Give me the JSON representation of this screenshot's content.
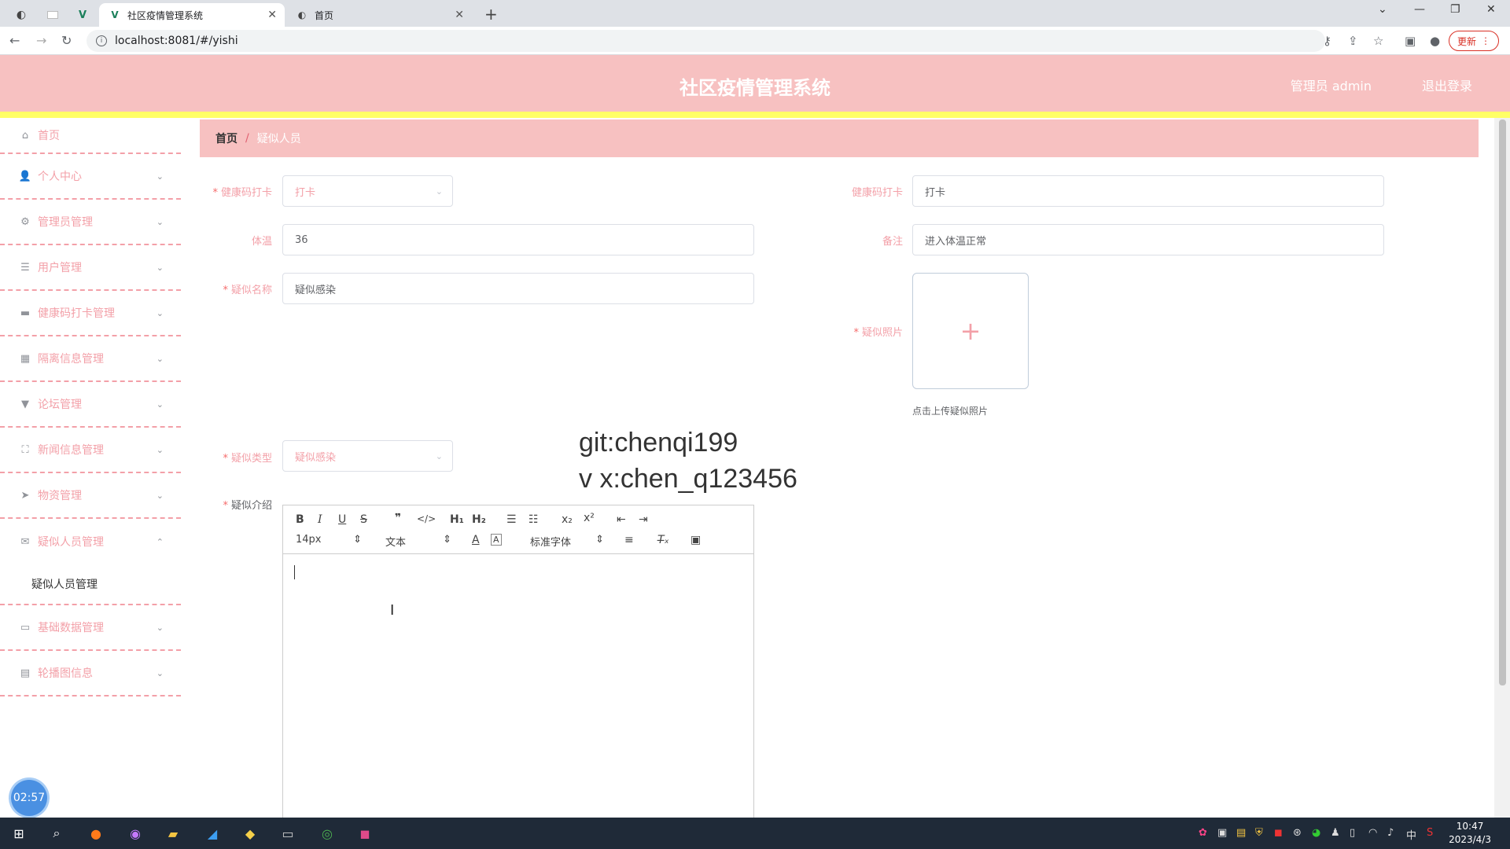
{
  "browser": {
    "tabs": [
      {
        "title": "社区疫情管理系统",
        "active": true
      },
      {
        "title": "首页",
        "active": false
      }
    ],
    "new_tab": "+",
    "url": "localhost:8081/#/yishi",
    "update_label": "更新"
  },
  "header": {
    "title": "社区疫情管理系统",
    "user": "管理员 admin",
    "logout": "退出登录"
  },
  "sidebar": {
    "items": [
      {
        "label": "首页",
        "icon": "home-icon"
      },
      {
        "label": "个人中心",
        "icon": "user-icon"
      },
      {
        "label": "管理员管理",
        "icon": "settings-icon"
      },
      {
        "label": "用户管理",
        "icon": "sliders-icon"
      },
      {
        "label": "健康码打卡管理",
        "icon": "briefcase-icon"
      },
      {
        "label": "隔离信息管理",
        "icon": "grid-icon"
      },
      {
        "label": "论坛管理",
        "icon": "pin-icon"
      },
      {
        "label": "新闻信息管理",
        "icon": "fullscreen-icon"
      },
      {
        "label": "物资管理",
        "icon": "send-icon"
      },
      {
        "label": "疑似人员管理",
        "icon": "ticket-icon"
      },
      {
        "label": "基础数据管理",
        "icon": "monitor-icon"
      },
      {
        "label": "轮播图信息",
        "icon": "clipboard-icon"
      }
    ],
    "submenu": {
      "label": "疑似人员管理"
    }
  },
  "breadcrumb": {
    "home": "首页",
    "separator": "/",
    "current": "疑似人员"
  },
  "form": {
    "health_checkin_select": {
      "label": "健康码打卡",
      "placeholder": "打卡"
    },
    "health_checkin_text": {
      "label": "健康码打卡",
      "value": "打卡"
    },
    "temperature": {
      "label": "体温",
      "value": "36"
    },
    "remark": {
      "label": "备注",
      "value": "进入体温正常"
    },
    "suspect_name": {
      "label": "疑似名称",
      "value": "疑似感染"
    },
    "suspect_photo": {
      "label": "疑似照片",
      "tip": "点击上传疑似照片"
    },
    "suspect_type": {
      "label": "疑似类型",
      "placeholder": "疑似感染"
    },
    "suspect_intro": {
      "label": "疑似介绍"
    }
  },
  "watermark": {
    "line1": "git:chenqi199",
    "line2": "v x:chen_q123456"
  },
  "editor": {
    "font_size": "14px",
    "header_select": "文本",
    "font_family": "标准字体"
  },
  "timer": "02:57",
  "clock": {
    "time": "10:47",
    "date": "2023/4/3"
  },
  "tray": {
    "ime": "中"
  }
}
